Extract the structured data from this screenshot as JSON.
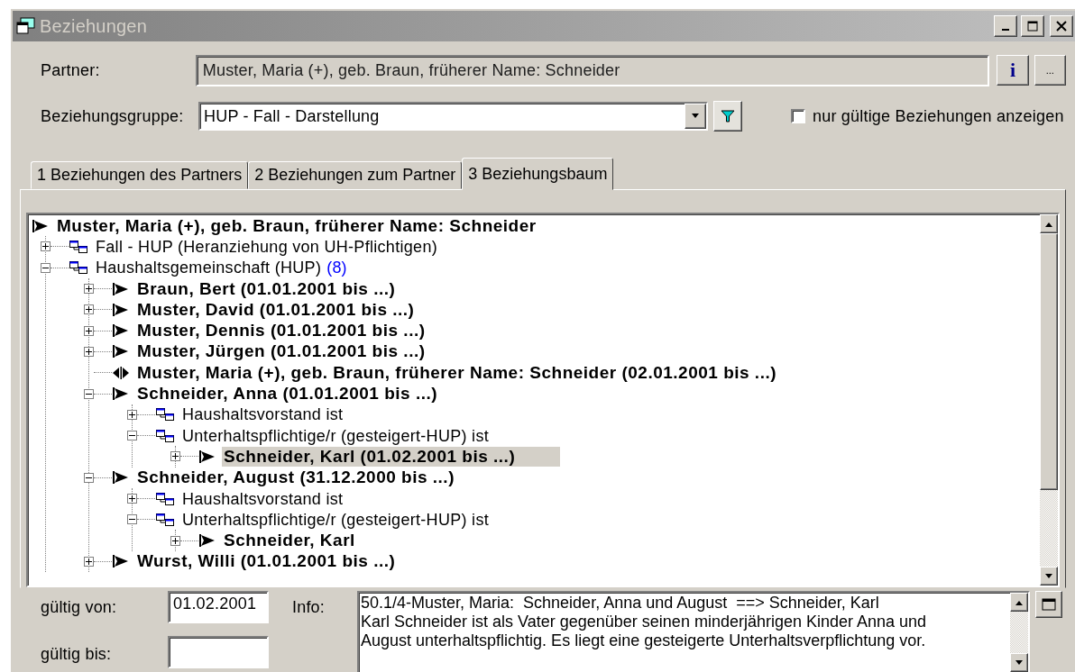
{
  "window": {
    "title": "Beziehungen"
  },
  "partner": {
    "label": "Partner:",
    "value": "Muster, Maria (+), geb. Braun, früherer Name: Schneider",
    "info_button": "i",
    "more_button": "..."
  },
  "group": {
    "label": "Beziehungsgruppe:",
    "value": "HUP - Fall - Darstellung"
  },
  "valid_only": {
    "label": "nur gültige Beziehungen anzeigen",
    "checked": false
  },
  "tabs": [
    {
      "label": "1 Beziehungen des Partners",
      "selected": false
    },
    {
      "label": "2 Beziehungen zum Partner",
      "selected": false
    },
    {
      "label": "3 Beziehungsbaum",
      "selected": true
    }
  ],
  "tree": {
    "kind": "person",
    "label": "Muster, Maria (+), geb. Braun, früherer Name: Schneider",
    "selected": false,
    "children": [
      {
        "kind": "group",
        "label": "Fall - HUP (Heranziehung von UH-Pflichtigen)",
        "expanded": false,
        "selected": false
      },
      {
        "kind": "group",
        "label": "Haushaltsgemeinschaft (HUP)",
        "count": "(8)",
        "expanded": true,
        "selected": false,
        "children": [
          {
            "kind": "person",
            "label": "Braun, Bert (01.01.2001 bis ...)",
            "expanded": false,
            "selected": false
          },
          {
            "kind": "person",
            "label": "Muster, David (01.01.2001 bis ...)",
            "expanded": false,
            "selected": false
          },
          {
            "kind": "person",
            "label": "Muster, Dennis (01.01.2001 bis ...)",
            "expanded": false,
            "selected": false
          },
          {
            "kind": "person",
            "label": "Muster, Jürgen (01.01.2001 bis ...)",
            "expanded": false,
            "selected": false
          },
          {
            "kind": "self",
            "label": "Muster, Maria (+), geb. Braun, früherer Name: Schneider (02.01.2001 bis ...)",
            "selected": false
          },
          {
            "kind": "person",
            "label": "Schneider, Anna (01.01.2001 bis ...)",
            "expanded": true,
            "selected": false,
            "children": [
              {
                "kind": "group",
                "label": "Haushaltsvorstand ist",
                "expanded": false,
                "selected": false
              },
              {
                "kind": "group",
                "label": "Unterhaltspflichtige/r (gesteigert-HUP) ist",
                "expanded": true,
                "selected": false,
                "children": [
                  {
                    "kind": "person",
                    "label": "Schneider, Karl (01.02.2001 bis ...)",
                    "expanded": false,
                    "selected": true
                  }
                ]
              }
            ]
          },
          {
            "kind": "person",
            "label": "Schneider, August (31.12.2000 bis ...)",
            "expanded": true,
            "selected": false,
            "children": [
              {
                "kind": "group",
                "label": "Haushaltsvorstand ist",
                "expanded": false,
                "selected": false
              },
              {
                "kind": "group",
                "label": "Unterhaltspflichtige/r (gesteigert-HUP) ist",
                "expanded": true,
                "selected": false,
                "children": [
                  {
                    "kind": "person",
                    "label": "Schneider, Karl",
                    "expanded": false,
                    "selected": false
                  }
                ]
              }
            ]
          },
          {
            "kind": "person",
            "label": "Wurst, Willi (01.01.2001 bis ...)",
            "expanded": false,
            "selected": false
          }
        ]
      }
    ]
  },
  "valid_from": {
    "label": "gültig von:",
    "value": "01.02.2001"
  },
  "valid_to": {
    "label": "gültig bis:"
  },
  "info": {
    "label": "Info:",
    "lines": [
      "50.1/4-Muster, Maria:  Schneider, Anna und August  ==> Schneider, Karl",
      "Karl Schneider ist als Vater gegenüber seinen minderjährigen Kinder Anna und",
      "August unterhaltspflichtig. Es liegt eine gesteigerte Unterhaltsverpflichtung vor."
    ]
  }
}
